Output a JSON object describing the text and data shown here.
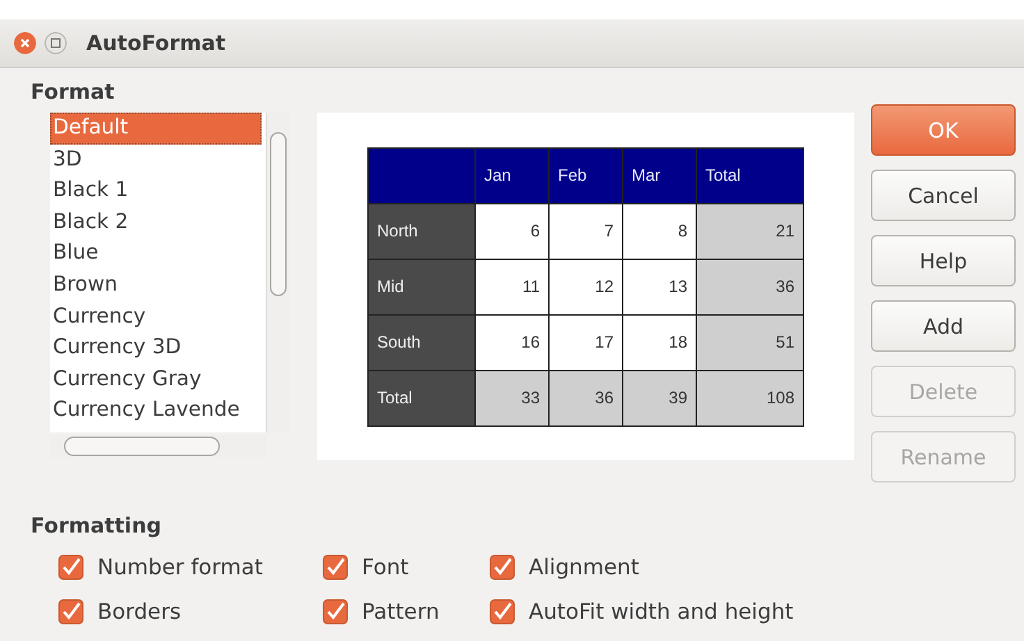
{
  "window": {
    "title": "AutoFormat"
  },
  "format": {
    "label": "Format",
    "items": [
      {
        "label": "Default",
        "selected": true
      },
      {
        "label": "3D",
        "selected": false
      },
      {
        "label": "Black 1",
        "selected": false
      },
      {
        "label": "Black 2",
        "selected": false
      },
      {
        "label": "Blue",
        "selected": false
      },
      {
        "label": "Brown",
        "selected": false
      },
      {
        "label": "Currency",
        "selected": false
      },
      {
        "label": "Currency 3D",
        "selected": false
      },
      {
        "label": "Currency Gray",
        "selected": false
      },
      {
        "label": "Currency Lavende",
        "selected": false
      }
    ]
  },
  "preview": {
    "columns": [
      "Jan",
      "Feb",
      "Mar",
      "Total"
    ],
    "rows": [
      {
        "label": "North",
        "values": [
          "6",
          "7",
          "8",
          "21"
        ]
      },
      {
        "label": "Mid",
        "values": [
          "11",
          "12",
          "13",
          "36"
        ]
      },
      {
        "label": "South",
        "values": [
          "16",
          "17",
          "18",
          "51"
        ]
      },
      {
        "label": "Total",
        "values": [
          "33",
          "36",
          "39",
          "108"
        ]
      }
    ]
  },
  "buttons": [
    {
      "label": "OK",
      "default": true,
      "disabled": false
    },
    {
      "label": "Cancel",
      "default": false,
      "disabled": false
    },
    {
      "label": "Help",
      "default": false,
      "disabled": false
    },
    {
      "label": "Add",
      "default": false,
      "disabled": false
    },
    {
      "label": "Delete",
      "default": false,
      "disabled": true
    },
    {
      "label": "Rename",
      "default": false,
      "disabled": true
    }
  ],
  "formatting": {
    "label": "Formatting",
    "options": [
      {
        "label": "Number format",
        "checked": true
      },
      {
        "label": "Font",
        "checked": true
      },
      {
        "label": "Alignment",
        "checked": true
      },
      {
        "label": "Borders",
        "checked": true
      },
      {
        "label": "Pattern",
        "checked": true
      },
      {
        "label": "AutoFit width and height",
        "checked": true
      }
    ]
  }
}
